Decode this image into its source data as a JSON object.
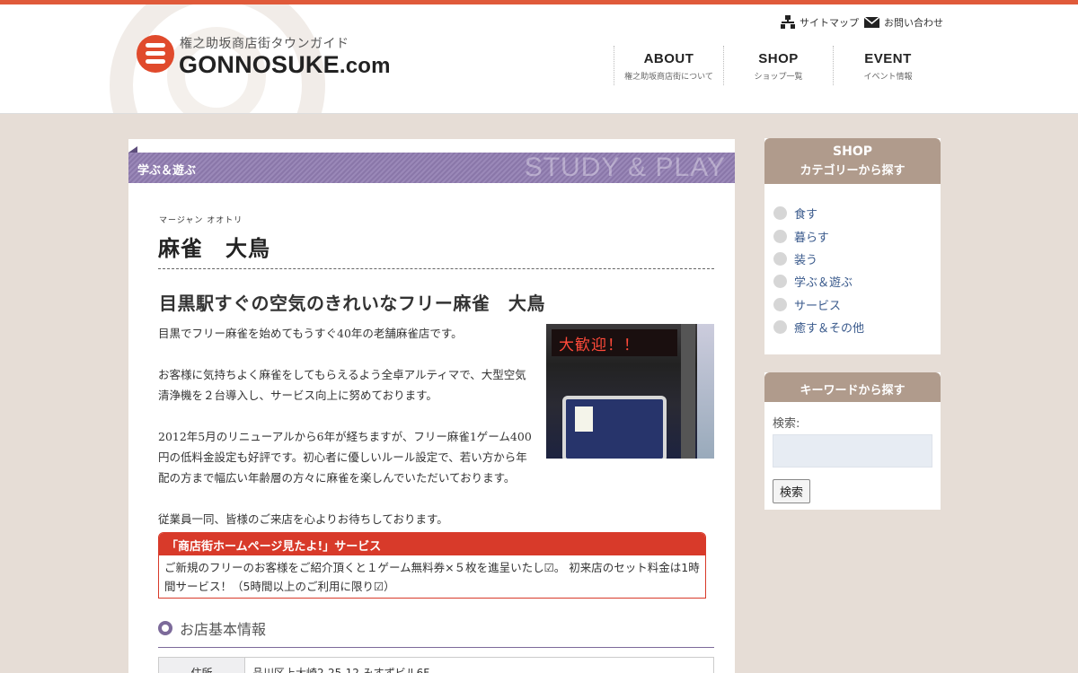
{
  "header": {
    "logo_sub": "権之助坂商店街タウンガイド",
    "logo_main": "GONNOSUKE",
    "logo_tld": ".com",
    "utility": [
      {
        "label": "サイトマップ",
        "icon": "sitemap-icon"
      },
      {
        "label": "お問い合わせ",
        "icon": "mail-icon"
      }
    ],
    "nav": [
      {
        "en": "ABOUT",
        "ja": "権之助坂商店街について"
      },
      {
        "en": "SHOP",
        "ja": "ショップ一覧"
      },
      {
        "en": "EVENT",
        "ja": "イベント情報"
      }
    ]
  },
  "category": {
    "label": "学ぶ＆遊ぶ",
    "label_en": "STUDY & PLAY"
  },
  "shop": {
    "ruby": "マージャン オオトリ",
    "name": "麻雀　大鳥",
    "headline": "目黒駅すぐの空気のきれいなフリー麻雀　大鳥",
    "paragraphs": [
      "目黒でフリー麻雀を始めてもうすぐ40年の老舗麻雀店です。",
      "お客様に気持ちよく麻雀をしてもらえるよう全卓アルティマで、大型空気清浄機を２台導入し、サービス向上に努めております。",
      "2012年5月のリニューアルから6年が経ちますが、フリー麻雀1ゲーム400円の低料金設定も好評です。初心者に優しいルール設定で、若い方から年配の方まで幅広い年齢層の方々に麻雀を楽しんでいただいております。",
      "従業員一同、皆様のご来店を心よりお待ちしております。"
    ],
    "photo_sign": "大歓迎！！",
    "service_title": "「商店街ホームページ見たよ!」サービス",
    "service_text": "ご新規のフリーのお客様をご紹介頂くと１ゲーム無料券×５枚を進呈いたし☑。 初来店のセット料金は1時間サービス！（5時間以上のご利用に限り☑）",
    "info_title": "お店基本情報",
    "info_rows": [
      {
        "label": "住所",
        "value": "品川区上大崎2-25-12 みすずビル6F"
      }
    ]
  },
  "sidebar": {
    "shop_title_1": "SHOP",
    "shop_title_2": "カテゴリーから探す",
    "categories": [
      "食す",
      "暮らす",
      "装う",
      "学ぶ＆遊ぶ",
      "サービス",
      "癒す＆その他"
    ],
    "keyword_title": "キーワードから探す",
    "search_label": "検索:",
    "search_button": "検索"
  },
  "colors": {
    "accent": "#e05a3a",
    "category_purple": "#8a77a9",
    "sidebar_head": "#b09b8c",
    "link": "#3a5a8c",
    "service_red": "#d83a2a"
  }
}
